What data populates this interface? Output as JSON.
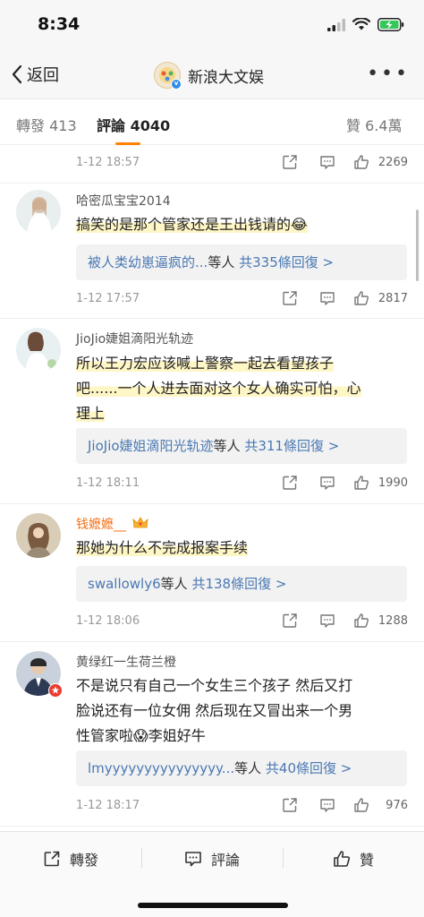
{
  "status_bar": {
    "time": "8:34"
  },
  "nav": {
    "back_label": "返回",
    "title": "新浪大文娱",
    "more": "•••"
  },
  "tabs": [
    {
      "label": "轉發",
      "count": "413"
    },
    {
      "label": "評論",
      "count": "4040"
    },
    {
      "label": "贊",
      "count": "6.4萬"
    }
  ],
  "top_meta": {
    "time": "1-12 18:57",
    "likes": "2269"
  },
  "comments": [
    {
      "username": "哈密瓜宝宝2014",
      "text": "搞笑的是那个管家还是王出钱请的",
      "emoji": "😂",
      "reply_user": "被人类幼崽逼疯的...",
      "reply_suffix": "等人",
      "reply_count": "共335條回復 >",
      "time": "1-12 17:57",
      "likes": "2817"
    },
    {
      "username": "JioJio婕姐滴阳光轨迹",
      "text_lines": [
        "所以王力宏应该喊上警察一起去看望孩子",
        "吧......一个人进去面对这个女人确实可怕，心",
        "理上"
      ],
      "reply_user": "JioJio婕姐滴阳光轨迹",
      "reply_suffix": "等人",
      "reply_count": "共311條回復 >",
      "time": "1-12 18:11",
      "likes": "1990"
    },
    {
      "username": "钱嬷嬷__",
      "text": "那她为什么不完成报案手续",
      "reply_user": "swallowly6",
      "reply_suffix": "等人",
      "reply_count": "共138條回復 >",
      "time": "1-12 18:06",
      "likes": "1288"
    },
    {
      "username": "黄绿红一生荷兰橙",
      "text_lines": [
        "不是说只有自己一个女生三个孩子 然后又打",
        "脸说还有一位女佣 然后现在又冒出来一个男",
        "性管家啦"
      ],
      "emoji": "😱",
      "text_tail": "李姐好牛",
      "reply_user": "lmyyyyyyyyyyyyyyy...",
      "reply_suffix": "等人",
      "reply_count": "共40條回復 >",
      "time": "1-12 18:17",
      "likes": "976"
    }
  ],
  "bottom_bar": {
    "repost": "轉發",
    "comment": "評論",
    "like": "贊"
  },
  "colors": {
    "accent": "#ff8200",
    "link": "#4a78b3",
    "highlight": "#fff6c6",
    "vip_name": "#f86f16"
  }
}
